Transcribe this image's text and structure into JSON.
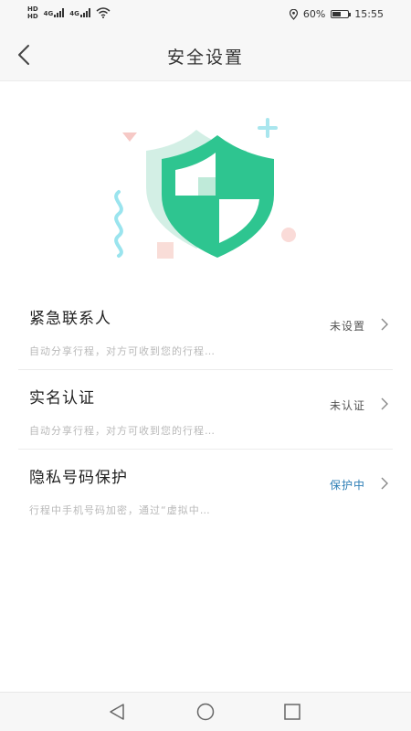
{
  "status_bar": {
    "hd1": "HD",
    "hd2": "HD",
    "net1": "4G",
    "net2": "4G",
    "battery_percent": "60%",
    "battery_level": 0.6,
    "time": "15:55",
    "icons": [
      "signal-icon",
      "wifi-icon",
      "location-icon",
      "battery-icon"
    ]
  },
  "header": {
    "title": "安全设置",
    "back_icon": "chevron-left-icon"
  },
  "colors": {
    "accent_green": "#2ec590",
    "light_green": "#bfead9",
    "status_blue": "#2f7fb6",
    "desc_gray": "#b9b9b9"
  },
  "items": [
    {
      "title": "紧急联系人",
      "status": "未设置",
      "desc": "自动分享行程，对方可收到您的行程…"
    },
    {
      "title": "实名认证",
      "status": "未认证",
      "desc": "自动分享行程，对方可收到您的行程…"
    },
    {
      "title": "隐私号码保护",
      "status": "保护中",
      "desc": "行程中手机号码加密，通过“虚拟中…"
    }
  ],
  "system_nav": [
    "back-triangle-icon",
    "home-circle-icon",
    "recents-square-icon"
  ]
}
